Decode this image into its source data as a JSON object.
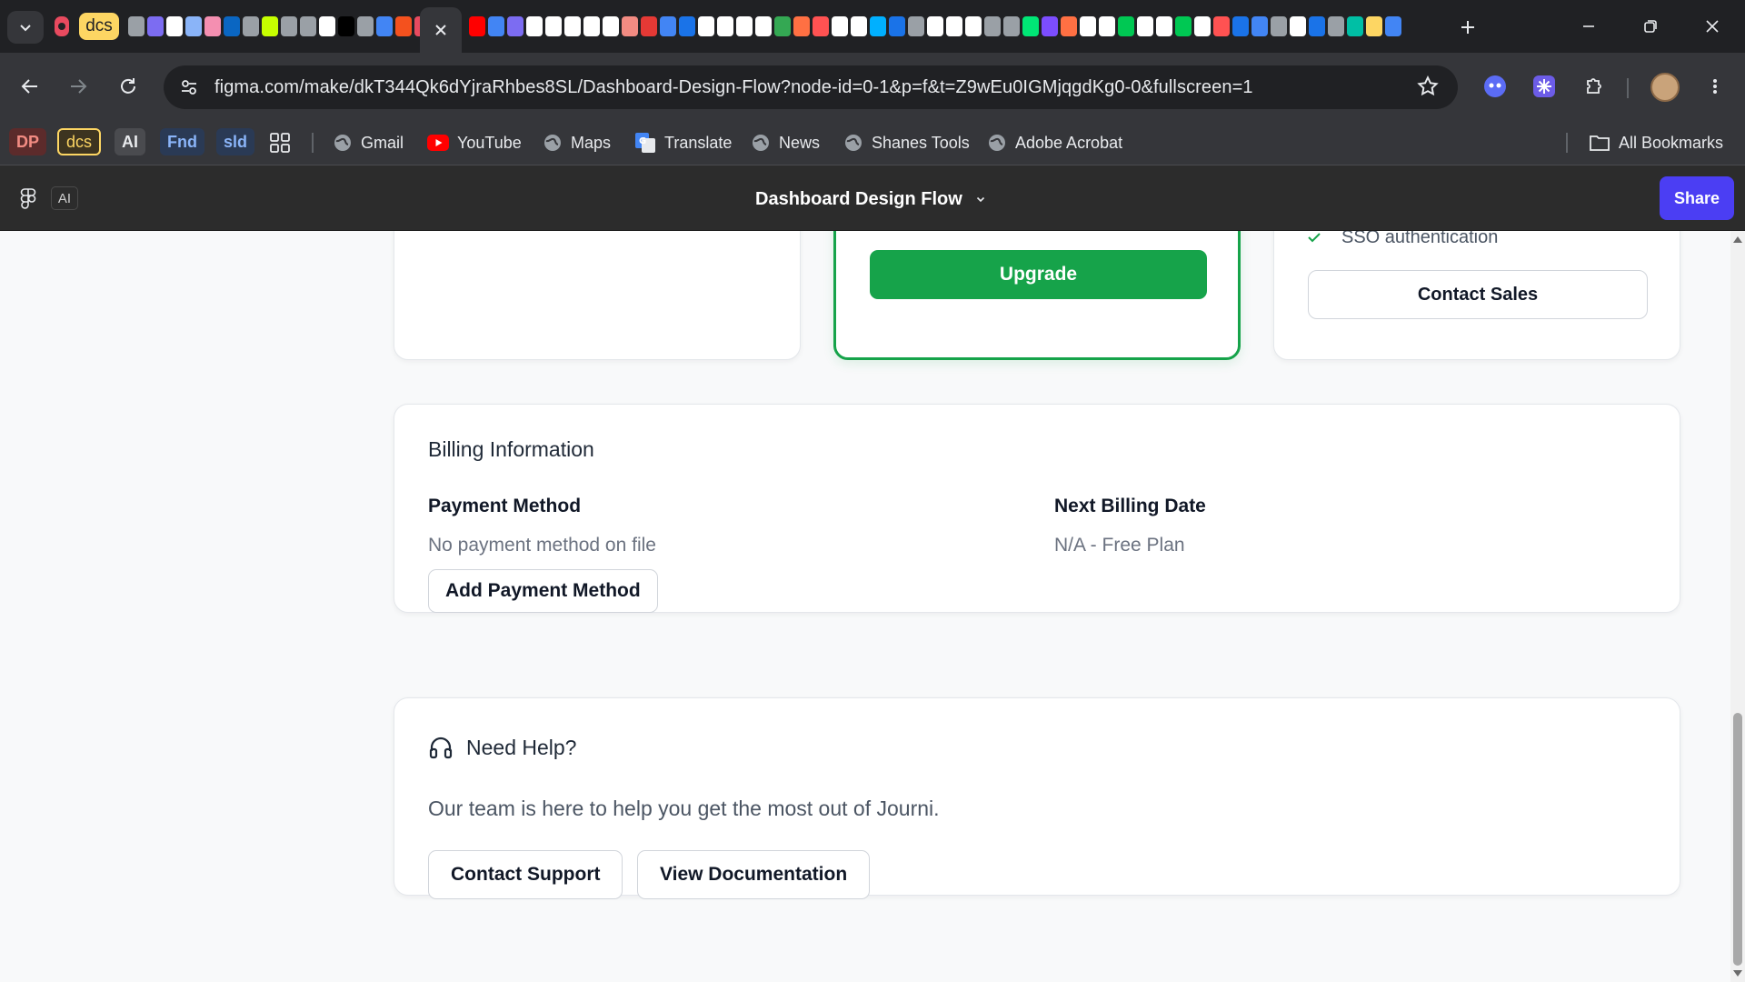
{
  "browser": {
    "pinned_label": "dcs",
    "url": "figma.com/make/dkT344Qk6dYjraRhbes8SL/Dashboard-Design-Flow?node-id=0-1&p=f&t=Z9wEu0IGMjqgdKg0-0&fullscreen=1",
    "favicon_colors_left": [
      "#9aa0a6",
      "#7c6cf2",
      "#ffffff",
      "#8ab4f8",
      "#f48fb1",
      "#0a66c2",
      "#9aa0a6",
      "#c6ff00",
      "#9aa0a6",
      "#9aa0a6",
      "#ffffff",
      "#000000",
      "#9aa0a6",
      "#4285f4",
      "#f4511e",
      "#e84a5f"
    ],
    "favicon_colors_right": [
      "#ff0000",
      "#4285f4",
      "#7c6cf2",
      "#ffffff",
      "#ffffff",
      "#ffffff",
      "#ffffff",
      "#ffffff",
      "#f28b82",
      "#e53935",
      "#4285f4",
      "#1a73e8",
      "#ffffff",
      "#ffffff",
      "#ffffff",
      "#ffffff",
      "#34a853",
      "#ff7043",
      "#ff5252",
      "#ffffff",
      "#ffffff",
      "#00b0ff",
      "#1a73e8",
      "#9aa0a6",
      "#ffffff",
      "#ffffff",
      "#ffffff",
      "#9aa0a6",
      "#9aa0a6",
      "#00e676",
      "#7c4dff",
      "#ff7043",
      "#ffffff",
      "#ffffff",
      "#00c853",
      "#ffffff",
      "#ffffff",
      "#00c853",
      "#ffffff",
      "#ff5252",
      "#1a73e8",
      "#4285f4",
      "#9aa0a6",
      "#ffffff",
      "#1a73e8",
      "#9aa0a6",
      "#00bfa5",
      "#fdd663",
      "#4285f4"
    ],
    "bookmarks": {
      "badges": [
        "DP",
        "dcs",
        "AI",
        "Fnd",
        "sld"
      ],
      "items": [
        "Gmail",
        "YouTube",
        "Maps",
        "Translate",
        "News",
        "Shanes Tools",
        "Adobe Acrobat"
      ],
      "all_bookmarks": "All Bookmarks"
    }
  },
  "figma": {
    "ai_chip": "AI",
    "title": "Dashboard Design Flow",
    "share_label": "Share",
    "accent_color": "#4b3ef3"
  },
  "plans": {
    "upgrade_label": "Upgrade",
    "enterprise_feature": "SSO authentication",
    "contact_sales_label": "Contact Sales",
    "highlight_color": "#16a34a"
  },
  "billing": {
    "title": "Billing Information",
    "payment_method_label": "Payment Method",
    "payment_method_value": "No payment method on file",
    "add_payment_label": "Add Payment Method",
    "next_billing_label": "Next Billing Date",
    "next_billing_value": "N/A - Free Plan"
  },
  "help": {
    "title": "Need Help?",
    "text": "Our team is here to help you get the most out of Journi.",
    "contact_support_label": "Contact Support",
    "view_docs_label": "View Documentation"
  }
}
